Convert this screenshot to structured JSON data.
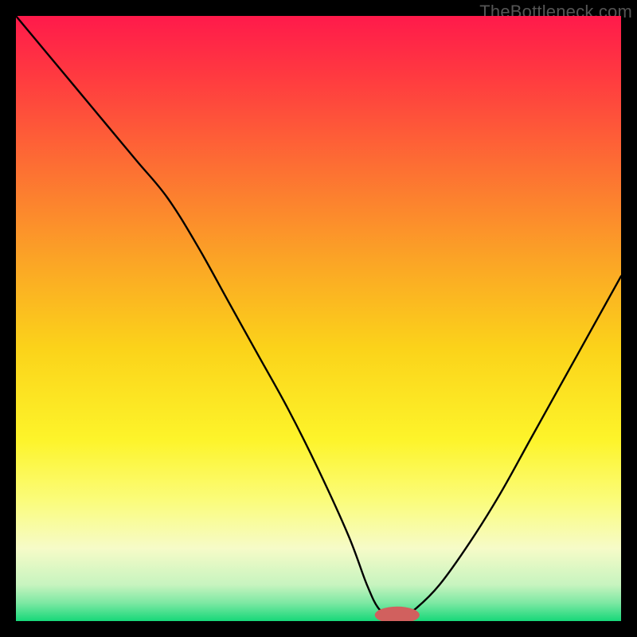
{
  "watermark": "TheBottleneck.com",
  "chart_data": {
    "type": "line",
    "title": "",
    "xlabel": "",
    "ylabel": "",
    "xlim": [
      0,
      100
    ],
    "ylim": [
      0,
      100
    ],
    "x": [
      0,
      5,
      10,
      15,
      20,
      25,
      30,
      35,
      40,
      45,
      50,
      55,
      58,
      60,
      62,
      64,
      66,
      70,
      75,
      80,
      85,
      90,
      95,
      100
    ],
    "values": [
      100,
      94,
      88,
      82,
      76,
      70,
      62,
      53,
      44,
      35,
      25,
      14,
      6,
      2,
      1,
      1,
      2,
      6,
      13,
      21,
      30,
      39,
      48,
      57
    ],
    "marker": {
      "x": 63,
      "y": 1,
      "rx": 3.7,
      "ry": 1.4,
      "color": "#d1605e"
    },
    "gradient_stops": [
      {
        "offset": 0.0,
        "color": "#ff1a4b"
      },
      {
        "offset": 0.1,
        "color": "#ff3a40"
      },
      {
        "offset": 0.25,
        "color": "#fd6f33"
      },
      {
        "offset": 0.4,
        "color": "#fba326"
      },
      {
        "offset": 0.55,
        "color": "#fbd31a"
      },
      {
        "offset": 0.7,
        "color": "#fdf42a"
      },
      {
        "offset": 0.8,
        "color": "#fbfc7a"
      },
      {
        "offset": 0.88,
        "color": "#f6fbc8"
      },
      {
        "offset": 0.94,
        "color": "#c7f4bf"
      },
      {
        "offset": 0.97,
        "color": "#7de8a3"
      },
      {
        "offset": 1.0,
        "color": "#17d879"
      }
    ]
  }
}
